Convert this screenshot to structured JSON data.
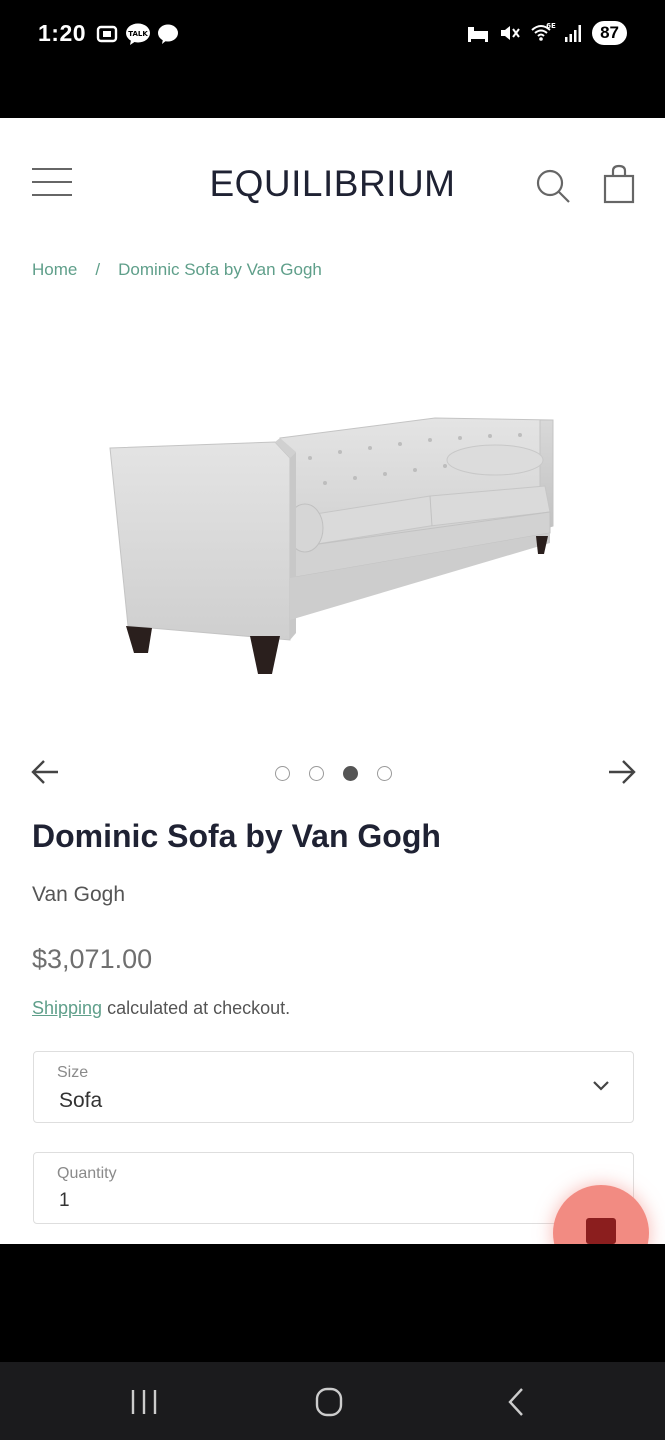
{
  "status_bar": {
    "time": "1:20",
    "battery": "87",
    "network": "6E",
    "left_icons": [
      "screenshot-icon",
      "talk-icon",
      "chat-bubble-icon"
    ],
    "right_icons": [
      "alarm-icon",
      "mute-icon",
      "wifi-6e-icon",
      "signal-icon"
    ]
  },
  "header": {
    "brand": "EQUILIBRIUM",
    "icons": [
      "hamburger-menu-icon",
      "search-icon",
      "shopping-bag-icon"
    ]
  },
  "breadcrumb": {
    "home": "Home",
    "separator": "/",
    "current": "Dominic Sofa by Van Gogh"
  },
  "product": {
    "title": "Dominic Sofa by Van Gogh",
    "vendor": "Van Gogh",
    "price": "$3,071.00",
    "shipping_link": "Shipping",
    "shipping_text": " calculated at checkout.",
    "gallery": {
      "image_count": 4,
      "active_index": 3
    }
  },
  "options": {
    "size": {
      "label": "Size",
      "value": "Sofa"
    },
    "quantity": {
      "label": "Quantity",
      "value": "1"
    }
  },
  "colors": {
    "accent": "#5f9f8a",
    "brand_text": "#1f2233",
    "fab": "#f28b82"
  }
}
